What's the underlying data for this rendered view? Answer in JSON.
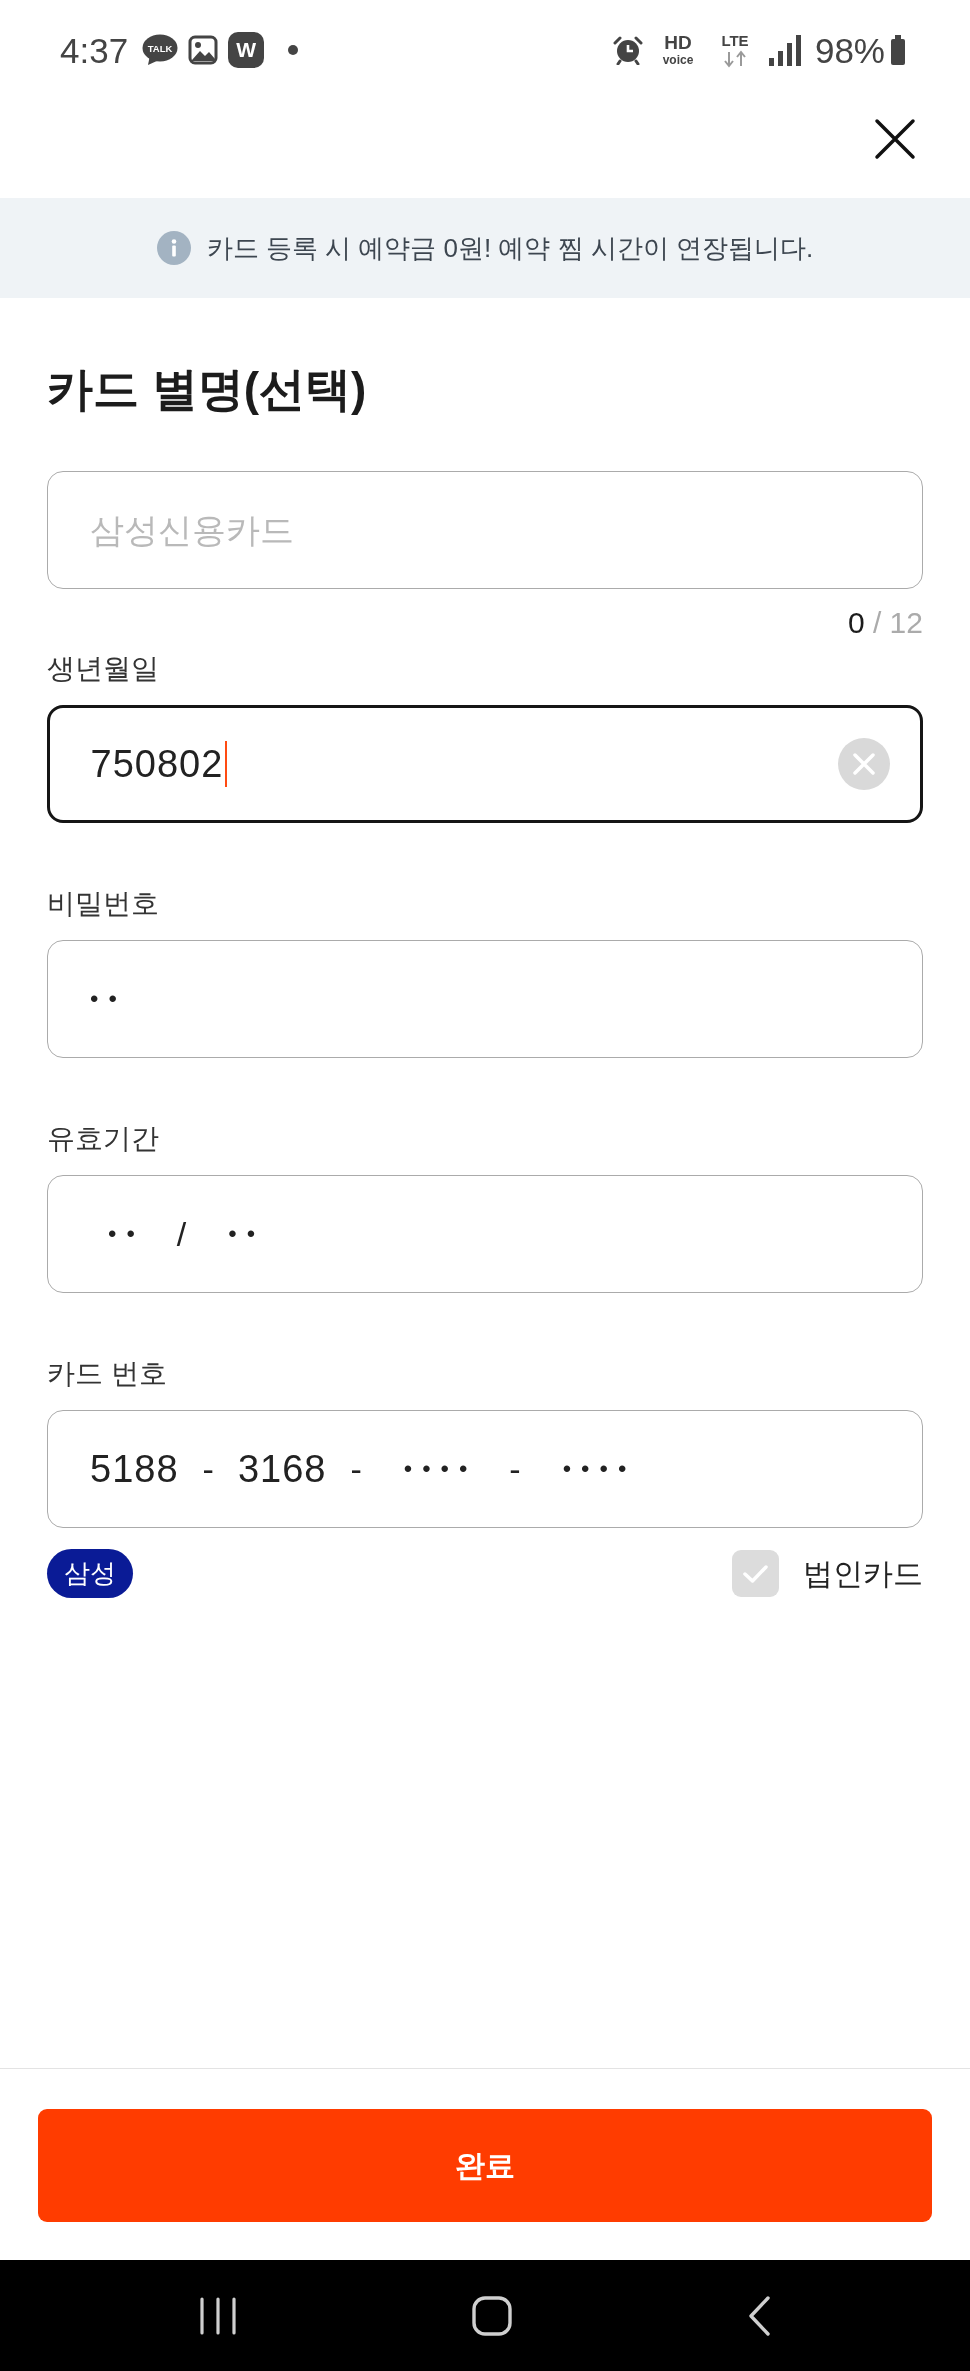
{
  "status_bar": {
    "time": "4:37",
    "notifications": [
      {
        "kind": "chat",
        "label": "TALK"
      },
      {
        "kind": "image"
      },
      {
        "kind": "app",
        "label": "W"
      },
      {
        "kind": "dot"
      }
    ],
    "indicators": [
      {
        "kind": "alarm"
      },
      {
        "kind": "hd_voice",
        "label": "HD",
        "sublabel": "voice"
      },
      {
        "kind": "network",
        "label": "LTE"
      },
      {
        "kind": "signal"
      }
    ],
    "battery": "98%"
  },
  "notice": {
    "text": "카드 등록 시 예약금 0원! 예약 찜 시간이 연장됩니다."
  },
  "title": "카드 별명(선택)",
  "fields": [
    {
      "placeholder": "삼성신용카드",
      "focused": false,
      "clear_button": false,
      "counter": {
        "current": "0",
        "limit": "/ 12"
      }
    },
    {
      "label": "생년월일",
      "parts": [
        {
          "kind": "digits",
          "text": "750802"
        }
      ],
      "focused": true,
      "clear_button": true
    },
    {
      "label": "비밀번호",
      "parts": [
        {
          "kind": "masked",
          "text": "••"
        }
      ],
      "focused": false,
      "clear_button": false
    },
    {
      "label": "유효기간",
      "parts": [
        {
          "kind": "masked",
          "text": "••"
        },
        {
          "kind": "separator",
          "text": "/"
        },
        {
          "kind": "masked",
          "text": "••"
        }
      ],
      "focused": false,
      "clear_button": false
    },
    {
      "label": "카드 번호",
      "parts": [
        {
          "kind": "digits",
          "text": "5188"
        },
        {
          "kind": "separator",
          "text": "-"
        },
        {
          "kind": "digits",
          "text": "3168"
        },
        {
          "kind": "separator",
          "text": "-"
        },
        {
          "kind": "masked",
          "text": "••••"
        },
        {
          "kind": "separator",
          "text": "-"
        },
        {
          "kind": "masked",
          "text": "••••"
        }
      ],
      "focused": false,
      "clear_button": false
    }
  ],
  "card_issuer": {
    "badge": "삼성"
  },
  "corporate_card": {
    "label": "법인카드",
    "checked": false
  },
  "submit": {
    "label": "완료"
  }
}
